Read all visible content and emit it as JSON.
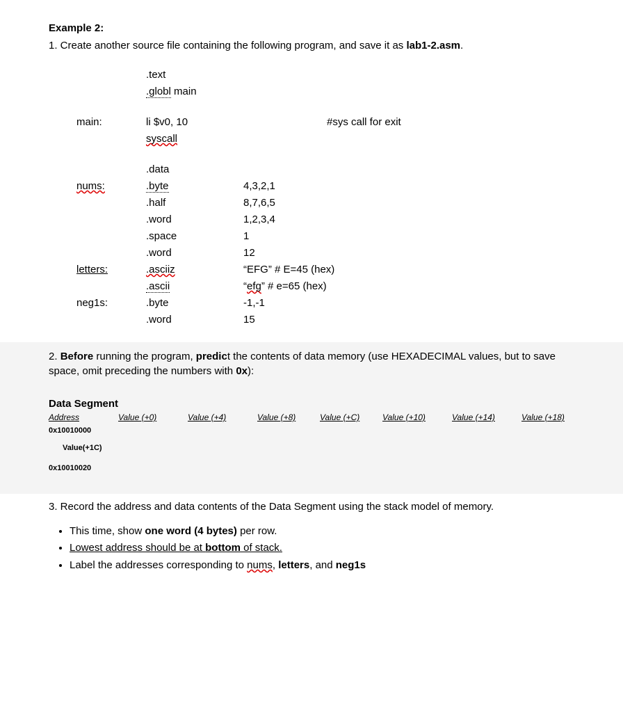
{
  "heading": "Example 2:",
  "p1a": "1.  Create another source file containing the following program, and save it as ",
  "p1b": "lab1-2.asm",
  "p1c": ".",
  "code": {
    "l1_dir": ".text",
    "l2_dir": ".globl",
    "l2_arg": " main",
    "l3_lbl": "main:",
    "l3_ins": "li $v0, 10",
    "l3_cmt": "#sys call for exit",
    "l4_ins": "syscall",
    "l5_dir": ".data",
    "l6_lbl": "nums:",
    "l6_dir": ".byte",
    "l6_val": "4,3,2,1",
    "l7_dir": ".half",
    "l7_val": "8,7,6,5",
    "l8_dir": ".word",
    "l8_val": "1,2,3,4",
    "l9_dir": ".space",
    "l9_val": " 1",
    "l10_dir": ".word",
    "l10_val": "12",
    "l11_lbl": "letters:",
    "l11_dir": ".asciiz",
    "l11_val": " “EFG”   # E=45 (hex)",
    "l12_dir": ".ascii",
    "l12_val_a": "  “",
    "l12_val_b": "efg",
    "l12_val_c": "”   # e=65 (hex)",
    "l13_lbl": "neg1s:",
    "l13_dir": ".byte",
    "l13_val": "  -1,-1",
    "l14_dir": ".word",
    "l14_val": "15"
  },
  "p2a": "2.  ",
  "p2b": "Before",
  "p2c": " running the program, ",
  "p2d": "predic",
  "p2e": "t the contents of data memory (use HEXADECIMAL values, but to save space, omit preceding the numbers with ",
  "p2f": "0x",
  "p2g": "):",
  "seg_title": "Data Segment",
  "seg_hdr": {
    "c0": "Address",
    "c1": "Value (+0)",
    "c2": "Value (+4)",
    "c3": "Value (+8)",
    "c4": "Value (+C)",
    "c5": "Value (+10)",
    "c6": "Value (+14)",
    "c7": "Value (+18)"
  },
  "seg_row0_addr": "0x10010000",
  "seg_row_indent": "Value(+1C)",
  "seg_row2_addr": "0x10010020",
  "p3": "3. Record the address and data contents of the Data Segment using the stack model of memory.",
  "b1a": "This time, show ",
  "b1b": "one word (4 bytes)",
  "b1c": " per row.",
  "b2a": "Lowest address should be at ",
  "b2b": "bottom",
  "b2c": " of stack.",
  "b3a": "Label the addresses corresponding to ",
  "b3b": "nums",
  "b3c": ", ",
  "b3d": "letters",
  "b3e": ", and ",
  "b3f": "neg1s"
}
